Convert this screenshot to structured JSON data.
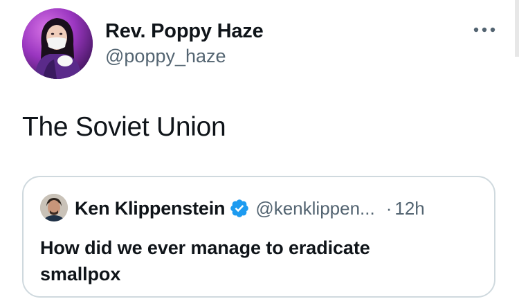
{
  "tweet": {
    "author": {
      "name": "Rev. Poppy Haze",
      "handle": "@poppy_haze"
    },
    "text": "The Soviet Union",
    "more_icon": "more-horizontal-icon"
  },
  "quote": {
    "author": {
      "name": "Ken Klippenstein",
      "handle": "@kenklippen...",
      "verified": true
    },
    "separator": "·",
    "time": "12h",
    "text": "How did we ever manage to eradicate smallpox"
  },
  "colors": {
    "text_primary": "#0f1419",
    "text_secondary": "#536471",
    "border": "#cfd9de",
    "verified_blue": "#1d9bf0"
  }
}
